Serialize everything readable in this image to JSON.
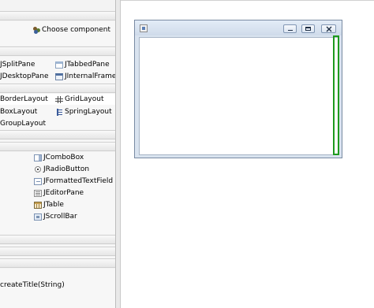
{
  "palette": {
    "choose_component": "Choose component",
    "containers": [
      "JSplitPane",
      "JTabbedPane",
      "JDesktopPane",
      "JInternalFrame"
    ],
    "layouts": [
      "BorderLayout",
      "GridLayout",
      "BoxLayout",
      "SpringLayout",
      "GroupLayout"
    ],
    "components": [
      "JComboBox",
      "JRadioButton",
      "JFormattedTextField",
      "JEditorPane",
      "JTable",
      "JScrollBar"
    ],
    "bottom_item": "createTitle(String)"
  },
  "icons": {
    "choose_component": "components-icon",
    "JTabbedPane": "tabbed-pane-icon",
    "JInternalFrame": "internal-frame-icon",
    "GridLayout": "grid-layout-icon",
    "SpringLayout": "spring-layout-icon",
    "JComboBox": "combobox-icon",
    "JRadioButton": "radio-button-icon",
    "JFormattedTextField": "formatted-text-field-icon",
    "JEditorPane": "editor-pane-icon",
    "JTable": "table-icon",
    "JScrollBar": "scrollbar-icon"
  },
  "colors": {
    "selection_outline": "#1e9a1e",
    "frame_title_bg": "#d9e3ef"
  }
}
